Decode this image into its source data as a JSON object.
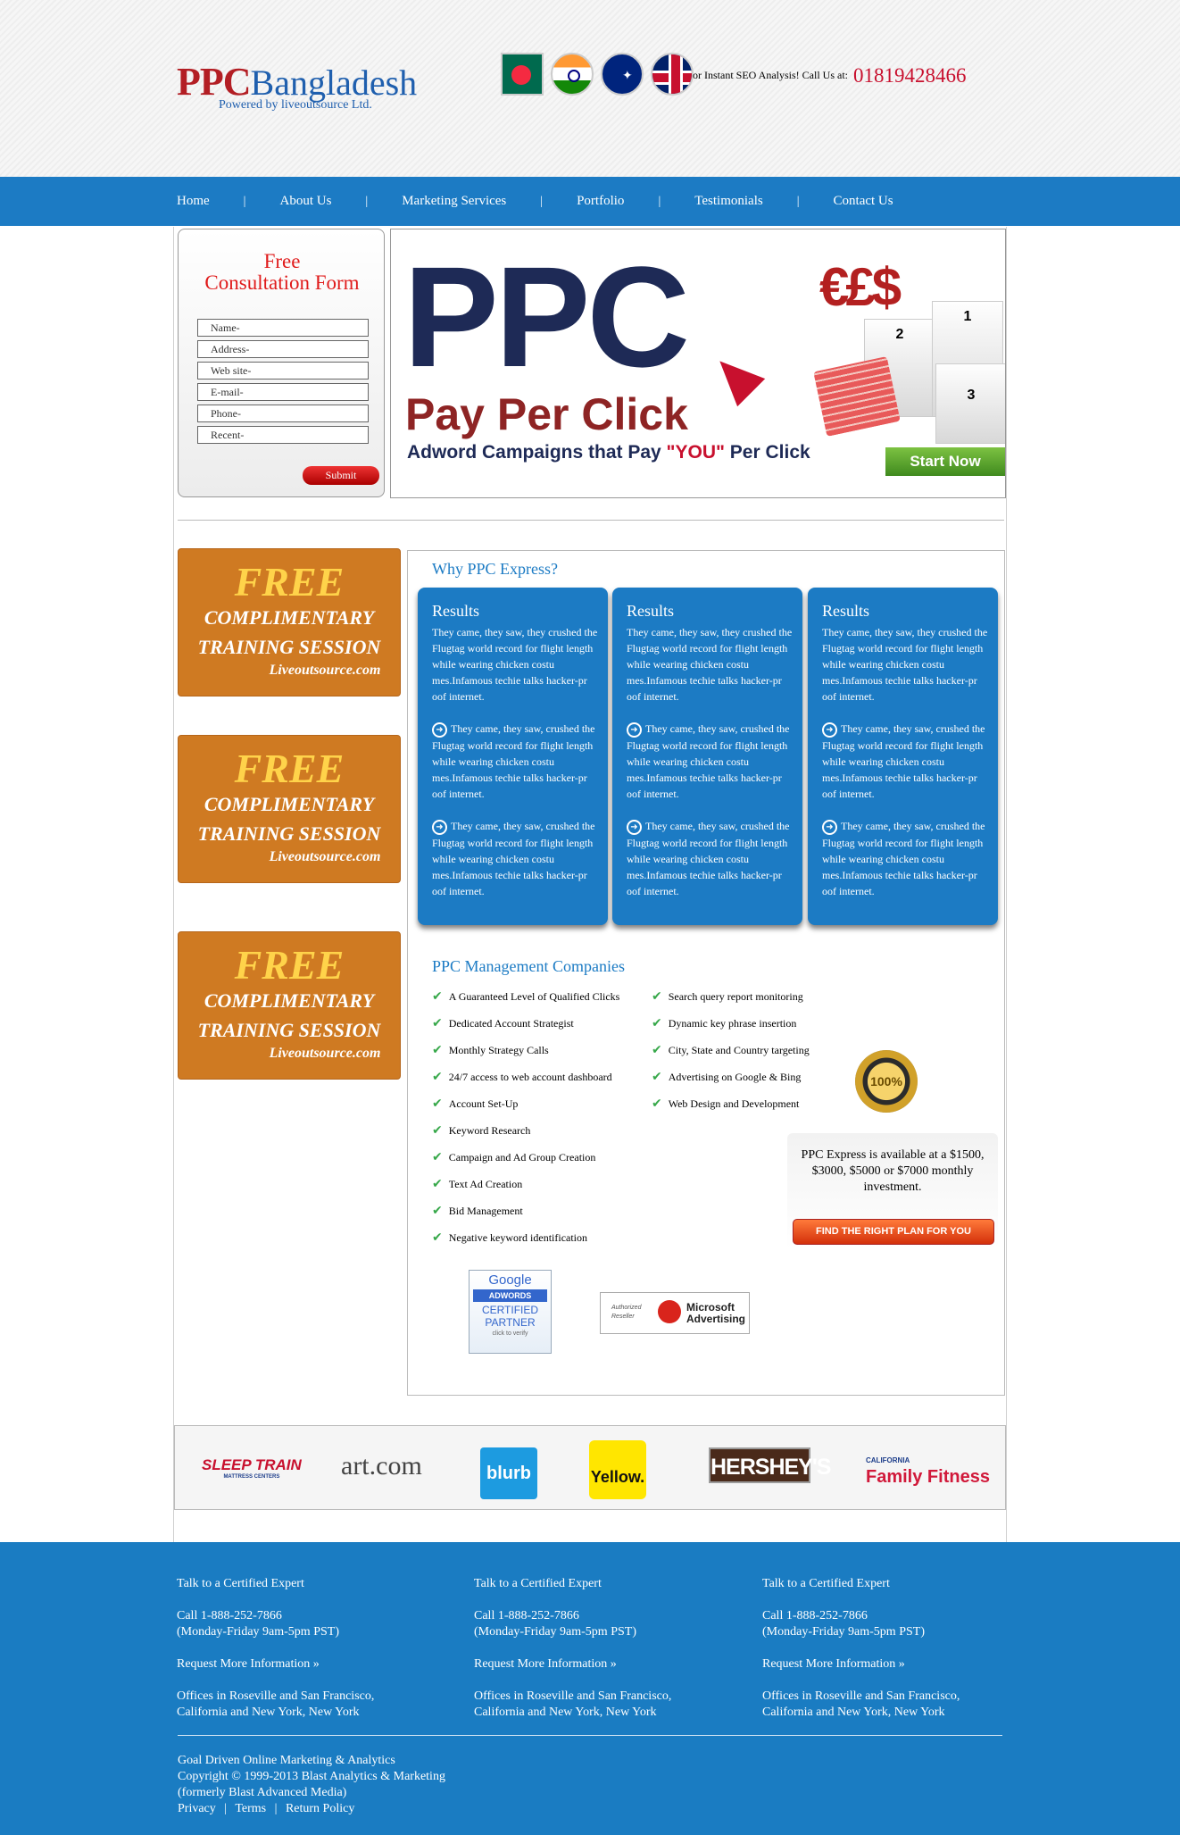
{
  "header": {
    "logo_ppc": "PPC",
    "logo_bangladesh": "Bangladesh",
    "powered_by": "Powered by liveoutsource Ltd.",
    "call_text": "or Instant SEO Analysis! Call Us at:",
    "phone": "01819428466"
  },
  "nav": {
    "items": [
      "Home",
      "About Us",
      "Marketing Services",
      "Portfolio",
      "Testimonials",
      "Contact Us"
    ],
    "separator": "|"
  },
  "form": {
    "title_line1": "Free",
    "title_line2": "Consultation Form",
    "fields": [
      "Name-",
      "Address-",
      "Web site-",
      "E-mail-",
      "Phone-",
      "Recent-"
    ],
    "submit_label": "Submit"
  },
  "hero": {
    "big_text": "PPC",
    "pay_per_click": "Pay Per Click",
    "tagline_before": "Adword Campaigns that Pay ",
    "tagline_you": "\"YOU\"",
    "tagline_after": " Per Click",
    "currency_symbols": "€£$",
    "podium_1": "1",
    "podium_2": "2",
    "podium_3": "3",
    "start_label": "Start Now"
  },
  "promos": [
    {
      "free": "FREE",
      "line1": "COMPLIMENTARY",
      "line2": "TRAINING SESSION",
      "site": "Liveoutsource.com"
    },
    {
      "free": "FREE",
      "line1": "COMPLIMENTARY",
      "line2": "TRAINING SESSION",
      "site": "Liveoutsource.com"
    },
    {
      "free": "FREE",
      "line1": "COMPLIMENTARY",
      "line2": "TRAINING SESSION",
      "site": "Liveoutsource.com"
    }
  ],
  "why": {
    "title": "Why PPC Express?",
    "cards": [
      {
        "title": "Results",
        "intro": "They came, they saw, they crushed the Flugtag world record for flight length while wearing chicken costu mes.Infamous techie talks hacker-pr oof internet.",
        "bullets": [
          "They came, they saw,  crushed the Flugtag world record for flight length while wearing chicken costu mes.Infamous techie talks hacker-pr oof internet.",
          "They came, they saw,  crushed the Flugtag world record for flight length while wearing chicken costu mes.Infamous techie talks hacker-pr oof internet."
        ]
      },
      {
        "title": "Results",
        "intro": "They came, they saw, they crushed the Flugtag world record for flight length while wearing chicken costu mes.Infamous techie talks hacker-pr oof internet.",
        "bullets": [
          "They came, they saw,  crushed the Flugtag world record for flight length while wearing chicken costu mes.Infamous techie talks hacker-pr oof internet.",
          "They came, they saw,  crushed the Flugtag world record for flight length while wearing chicken costu mes.Infamous techie talks hacker-pr oof internet."
        ]
      },
      {
        "title": "Results",
        "intro": "They came, they saw, they crushed the Flugtag world record for flight length while wearing chicken costu mes.Infamous techie talks hacker-pr oof internet.",
        "bullets": [
          "They came, they saw,  crushed the Flugtag world record for flight length while wearing chicken costu mes.Infamous techie talks hacker-pr oof internet.",
          "They came, they saw,  crushed the Flugtag world record for flight length while wearing chicken costu mes.Infamous techie talks hacker-pr oof internet."
        ]
      }
    ]
  },
  "management": {
    "title": "PPC Management Companies",
    "left": [
      "A Guaranteed Level of Qualified  Clicks",
      "Dedicated Account Strategist",
      "Monthly Strategy Calls",
      "24/7 access to web account dashboard",
      "Account Set-Up",
      "Keyword Research",
      "Campaign and Ad Group Creation",
      "Text Ad Creation",
      "Bid Management",
      "Negative keyword identification"
    ],
    "right": [
      "Search query report monitoring",
      "Dynamic key phrase insertion",
      "City, State and Country targeting",
      "Advertising on Google & Bing",
      "Web Design and Development"
    ],
    "seal_text": "100%",
    "plan_text": "PPC Express is available at a $1500, $3000, $5000 or $7000 monthly investment.",
    "plan_button": "FIND THE RIGHT PLAN FOR YOU"
  },
  "badges": {
    "google_logo": "Google",
    "google_adwords": "ADWORDS",
    "google_certified": "CERTIFIED",
    "google_partner": "PARTNER",
    "google_verify": "click to verify",
    "ms_authorized": "Authorized",
    "ms_reseller": "Reseller",
    "ms_name1": "Microsoft",
    "ms_name2": "Advertising"
  },
  "clients": {
    "sleep_train": "SLEEP TRAIN",
    "sleep_sub": "MATTRESS CENTERS",
    "art": "art.com",
    "blurb": "blurb",
    "yellow": "Yellow.",
    "hersheys": "HERSHEY'S",
    "cal_top": "CALIFORNIA",
    "cal_main": "Family Fitness"
  },
  "footer": {
    "columns": [
      {
        "heading": "Talk to a Certified Expert",
        "call": "Call 1-888-252-7866",
        "hours": "(Monday-Friday 9am-5pm PST)",
        "request": "Request More Information »",
        "offices1": "Offices in Roseville and San Francisco,",
        "offices2": "California and New York, New York"
      },
      {
        "heading": "Talk to a Certified Expert",
        "call": "Call 1-888-252-7866",
        "hours": "(Monday-Friday 9am-5pm PST)",
        "request": "Request More Information »",
        "offices1": "Offices in Roseville and San Francisco,",
        "offices2": "California and New York, New York"
      },
      {
        "heading": "Talk to a Certified Expert",
        "call": "Call 1-888-252-7866",
        "hours": "(Monday-Friday 9am-5pm PST)",
        "request": "Request More Information »",
        "offices1": "Offices in Roseville and San Francisco,",
        "offices2": "California and New York, New York"
      }
    ],
    "tagline": "Goal Driven Online Marketing & Analytics",
    "copyright": "Copyright © 1999-2013 Blast Analytics & Marketing",
    "formerly": "(formerly Blast Advanced Media)",
    "links": [
      "Privacy",
      "Terms",
      "Return Policy"
    ],
    "link_sep": "|"
  },
  "colors": {
    "nav_blue": "#1c7bc4",
    "promo_orange": "#cf7a22",
    "accent_red": "#c8102e",
    "check_green": "#37a84a"
  }
}
